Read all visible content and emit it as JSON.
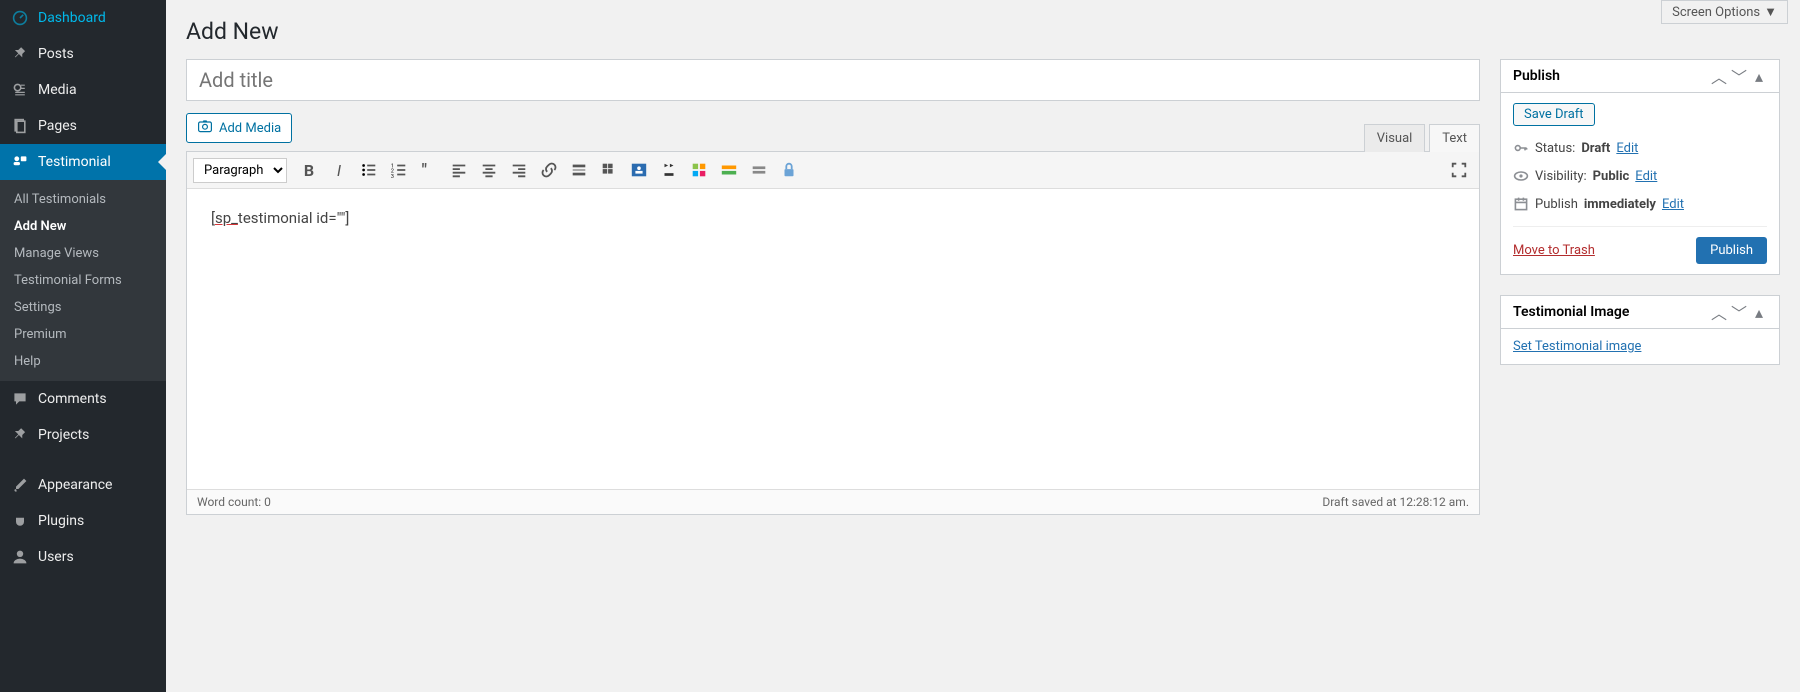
{
  "screen_options": "Screen Options",
  "page_title": "Add New",
  "title_placeholder": "Add title",
  "sidebar": {
    "items": [
      {
        "label": "Dashboard"
      },
      {
        "label": "Posts"
      },
      {
        "label": "Media"
      },
      {
        "label": "Pages"
      },
      {
        "label": "Testimonial"
      },
      {
        "label": "Comments"
      },
      {
        "label": "Projects"
      },
      {
        "label": "Appearance"
      },
      {
        "label": "Plugins"
      },
      {
        "label": "Users"
      }
    ],
    "sub": [
      "All Testimonials",
      "Add New",
      "Manage Views",
      "Testimonial Forms",
      "Settings",
      "Premium",
      "Help"
    ]
  },
  "add_media": "Add Media",
  "editor_tabs": {
    "visual": "Visual",
    "text": "Text"
  },
  "toolbar": {
    "paragraph": "Paragraph"
  },
  "content_prefix": "[sp_",
  "content_rest": "testimonial id=\"\"]",
  "footer": {
    "wordcount": "Word count: 0",
    "draft_saved": "Draft saved at 12:28:12 am."
  },
  "publish": {
    "title": "Publish",
    "save_draft": "Save Draft",
    "status_label": "Status:",
    "status_value": "Draft",
    "visibility_label": "Visibility:",
    "visibility_value": "Public",
    "publish_label": "Publish",
    "publish_value": "immediately",
    "edit": "Edit",
    "trash": "Move to Trash",
    "button": "Publish"
  },
  "image_box": {
    "title": "Testimonial Image",
    "link": "Set Testimonial image"
  }
}
